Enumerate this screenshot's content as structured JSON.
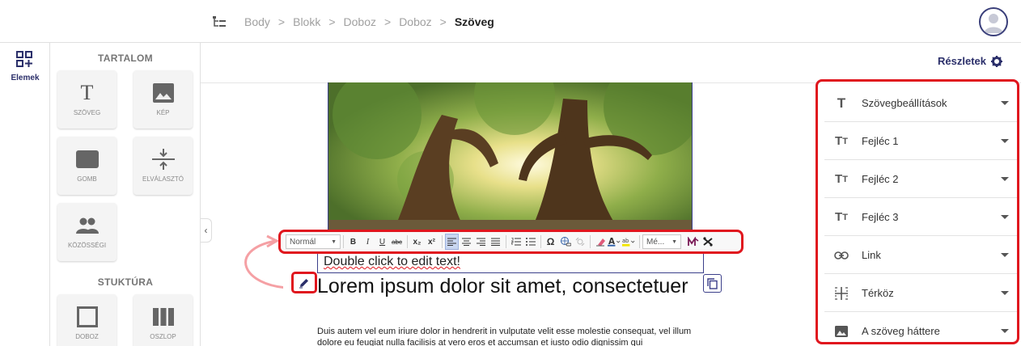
{
  "breadcrumb": {
    "items": [
      "Body",
      "Blokk",
      "Doboz",
      "Doboz"
    ],
    "separator": ">",
    "current": "Szöveg"
  },
  "rail": {
    "elements_label": "Elemek"
  },
  "panel": {
    "content_title": "TARTALOM",
    "structure_title": "STUKTÚRA",
    "tiles": {
      "text": "SZÖVEG",
      "image": "KÉP",
      "button": "GOMB",
      "divider": "ELVÁLASZTÓ",
      "social": "KÖZÖSSÉGI",
      "box": "DOBOZ",
      "column": "OSZLOP"
    }
  },
  "details": {
    "label": "Részletek"
  },
  "toolbar": {
    "format_select": "Normál",
    "size_select": "Mé...",
    "bold": "B",
    "italic": "I",
    "underline": "U",
    "strike": "abc",
    "subscript": "x₂",
    "superscript": "x²",
    "special_char": "Ω"
  },
  "canvas": {
    "edit_hint": "Double click to edit text!",
    "heading": "Lorem ipsum dolor sit amet, consectetuer",
    "body": "Duis autem vel eum iriure dolor in hendrerit in vulputate velit esse molestie consequat, vel illum dolore eu feugiat nulla facilisis at vero eros et accumsan et iusto odio dignissim qui"
  },
  "settings": {
    "rows": [
      {
        "label": "Szövegbeállítások",
        "icon": "text-icon"
      },
      {
        "label": "Fejléc 1",
        "icon": "heading-icon"
      },
      {
        "label": "Fejléc 2",
        "icon": "heading-icon"
      },
      {
        "label": "Fejléc 3",
        "icon": "heading-icon"
      },
      {
        "label": "Link",
        "icon": "link-icon"
      },
      {
        "label": "Térköz",
        "icon": "spacing-icon"
      },
      {
        "label": "A szöveg háttere",
        "icon": "image-icon"
      }
    ]
  },
  "colors": {
    "accent": "#2b2f6a",
    "highlight_red": "#e0161e",
    "selection_blue": "#3b3f8a"
  }
}
